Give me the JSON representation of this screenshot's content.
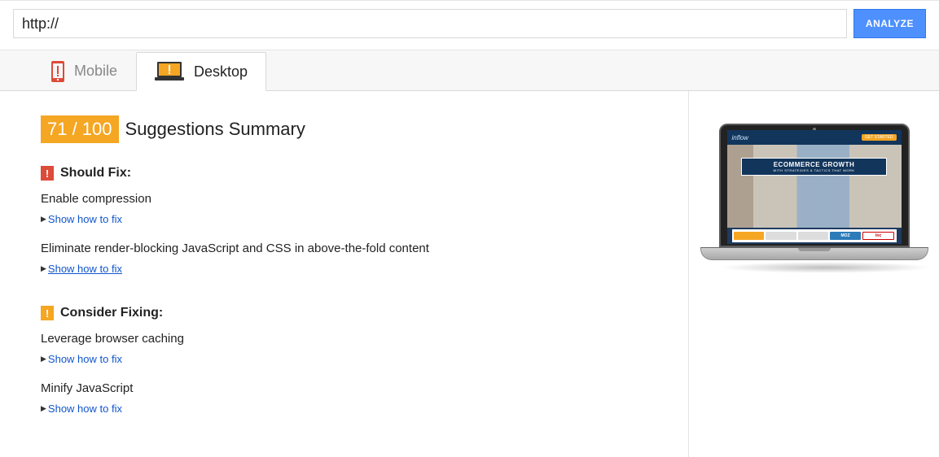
{
  "search": {
    "value": "http://",
    "button": "ANALYZE"
  },
  "tabs": {
    "mobile": "Mobile",
    "desktop": "Desktop"
  },
  "score": "71 / 100",
  "summary_title": "Suggestions Summary",
  "sections": {
    "should_fix": {
      "label": "Should Fix:",
      "rules": [
        {
          "title": "Enable compression",
          "action": "Show how to fix"
        },
        {
          "title": "Eliminate render-blocking JavaScript and CSS in above-the-fold content",
          "action": "Show how to fix"
        }
      ]
    },
    "consider_fixing": {
      "label": "Consider Fixing:",
      "rules": [
        {
          "title": "Leverage browser caching",
          "action": "Show how to fix"
        },
        {
          "title": "Minify JavaScript",
          "action": "Show how to fix"
        }
      ]
    }
  },
  "preview": {
    "brand": "inflow",
    "cta": "GET STARTED",
    "hero_big": "ECOMMERCE GROWTH",
    "hero_small": "WITH STRATEGIES & TACTICS THAT WORK",
    "logo_moz": "MOZ",
    "logo_inc": "Inc"
  }
}
